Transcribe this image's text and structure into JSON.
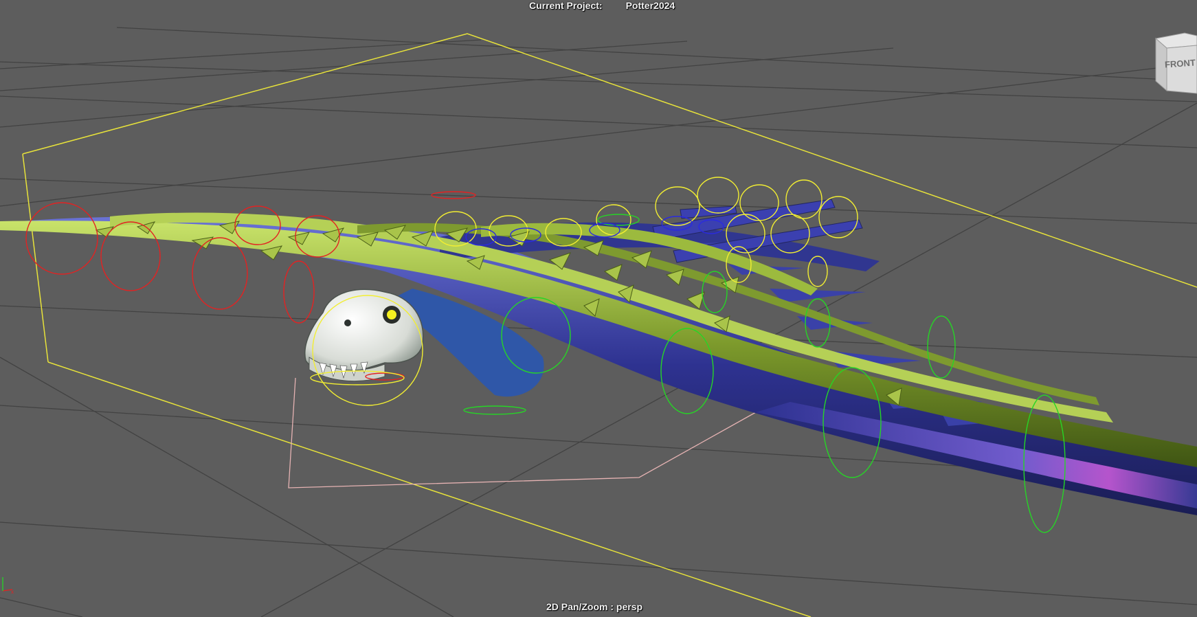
{
  "header": {
    "label": "Current Project:",
    "project_name": "Potter2024"
  },
  "viewcube": {
    "face_label": "FRONT"
  },
  "status": {
    "panzoom": "2D Pan/Zoom : persp"
  },
  "colors": {
    "background": "#5d5d5d",
    "grid": "#3f3f3f",
    "bounding_box": "#e8e33a",
    "camera_frame": "#e6b3b3",
    "controls_red": "#e32222",
    "controls_yellow": "#f2ee32",
    "controls_green": "#26d526",
    "controls_blue": "#2a2ae0",
    "body_purple": "#3b3fa8",
    "spine_green": "#8ea83a"
  }
}
